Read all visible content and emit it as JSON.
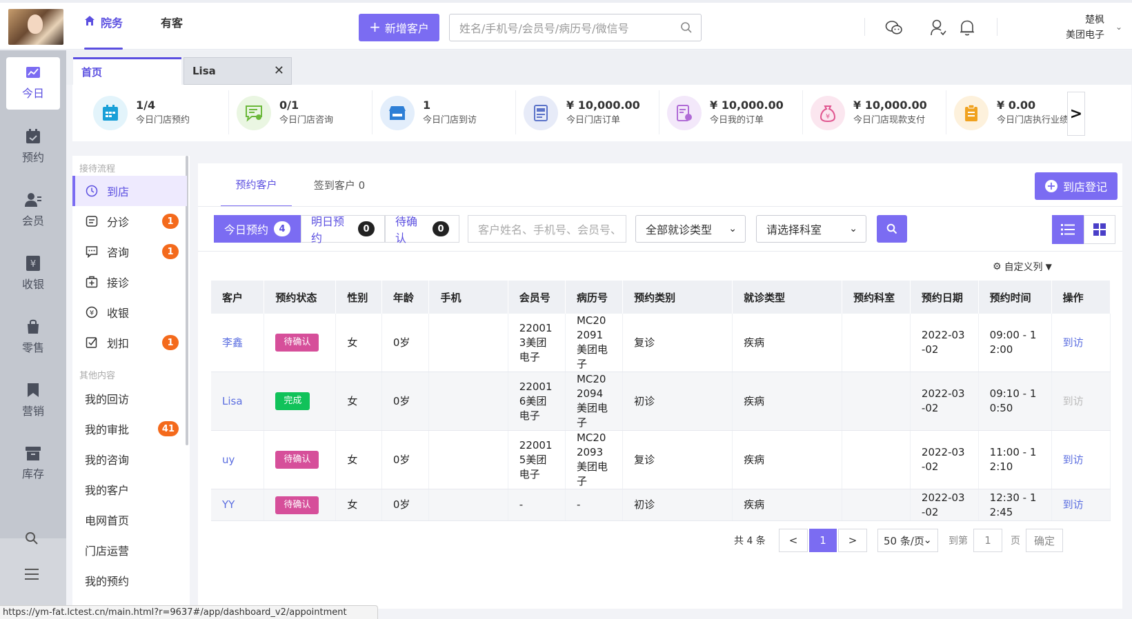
{
  "header": {
    "nav": [
      {
        "label": "院务"
      },
      {
        "label": "有客"
      }
    ],
    "add_customer": "新增客户",
    "search_placeholder": "姓名/手机号/会员号/病历号/微信号",
    "user_name": "楚枫",
    "company": "美团电子"
  },
  "sidebar": {
    "items": [
      {
        "label": "今日",
        "icon": "chart-icon"
      },
      {
        "label": "预约",
        "icon": "calendar-icon"
      },
      {
        "label": "会员",
        "icon": "member-icon"
      },
      {
        "label": "收银",
        "icon": "yen-icon"
      },
      {
        "label": "零售",
        "icon": "bag-icon"
      },
      {
        "label": "营销",
        "icon": "bookmark-icon"
      },
      {
        "label": "库存",
        "icon": "box-icon"
      }
    ]
  },
  "tabs": [
    {
      "label": "首页"
    },
    {
      "label": "Lisa"
    }
  ],
  "stats": [
    {
      "value": "1/4",
      "label": "今日门店预约",
      "color": "#1aa0d8",
      "bg": "#e3f4fb"
    },
    {
      "value": "0/1",
      "label": "今日门店咨询",
      "color": "#6bb83a",
      "bg": "#eaf6e2"
    },
    {
      "value": "1",
      "label": "今日门店到访",
      "color": "#2e7fd6",
      "bg": "#e3eefb"
    },
    {
      "value": "¥ 10,000.00",
      "label": "今日门店订单",
      "color": "#5b73c9",
      "bg": "#e7ebf8"
    },
    {
      "value": "¥ 10,000.00",
      "label": "今日我的订单",
      "color": "#b06bd6",
      "bg": "#f3e8fa"
    },
    {
      "value": "¥ 10,000.00",
      "label": "今日门店现款支付",
      "color": "#e0558f",
      "bg": "#fbe6ef"
    },
    {
      "value": "¥ 0.00",
      "label": "今日门店执行业绩",
      "color": "#f0a21f",
      "bg": "#fdf1dc"
    }
  ],
  "flow_menu": {
    "section1": "接待流程",
    "items1": [
      {
        "label": "到店",
        "badge": ""
      },
      {
        "label": "分诊",
        "badge": "1"
      },
      {
        "label": "咨询",
        "badge": "1"
      },
      {
        "label": "接诊",
        "badge": ""
      },
      {
        "label": "收银",
        "badge": ""
      },
      {
        "label": "划扣",
        "badge": "1"
      }
    ],
    "section2": "其他内容",
    "items2": [
      {
        "label": "我的回访",
        "badge": ""
      },
      {
        "label": "我的审批",
        "badge": "41"
      },
      {
        "label": "我的咨询",
        "badge": ""
      },
      {
        "label": "我的客户",
        "badge": ""
      },
      {
        "label": "电网首页",
        "badge": ""
      },
      {
        "label": "门店运营",
        "badge": ""
      },
      {
        "label": "我的预约",
        "badge": ""
      }
    ]
  },
  "main": {
    "tabs": [
      {
        "label": "预约客户"
      },
      {
        "label": "签到客户 0"
      }
    ],
    "checkin_button": "到店登记",
    "segments": [
      {
        "label": "今日预约",
        "count": "4"
      },
      {
        "label": "明日预约",
        "count": "0"
      },
      {
        "label": "待确认",
        "count": "0"
      }
    ],
    "filter_placeholder": "客户姓名、手机号、会员号、",
    "visit_type_select": "全部就诊类型",
    "dept_select": "请选择科室",
    "custom_columns": "自定义列"
  },
  "table": {
    "columns": [
      "客户",
      "预约状态",
      "性别",
      "年龄",
      "手机",
      "会员号",
      "病历号",
      "预约类别",
      "就诊类型",
      "预约科室",
      "预约日期",
      "预约时间",
      "操作"
    ],
    "rows": [
      {
        "name": "李鑫",
        "status": "待确认",
        "gender": "女",
        "age": "0岁",
        "phone": "",
        "member": "220013美团电子",
        "record": "MC202091美团电子",
        "category": "复诊",
        "visit": "疾病",
        "dept": "",
        "date": "2022-03-02",
        "time": "09:00 - 12:00",
        "action": "到访"
      },
      {
        "name": "Lisa",
        "status": "完成",
        "gender": "女",
        "age": "0岁",
        "phone": "",
        "member": "220016美团电子",
        "record": "MC202094美团电子",
        "category": "初诊",
        "visit": "疾病",
        "dept": "",
        "date": "2022-03-02",
        "time": "09:10 - 10:50",
        "action": "到访"
      },
      {
        "name": "uy",
        "status": "待确认",
        "gender": "女",
        "age": "0岁",
        "phone": "",
        "member": "220015美团电子",
        "record": "MC202093美团电子",
        "category": "复诊",
        "visit": "疾病",
        "dept": "",
        "date": "2022-03-02",
        "time": "11:00 - 12:10",
        "action": "到访"
      },
      {
        "name": "YY",
        "status": "待确认",
        "gender": "女",
        "age": "0岁",
        "phone": "",
        "member": "-",
        "record": "-",
        "category": "初诊",
        "visit": "疾病",
        "dept": "",
        "date": "2022-03-02",
        "time": "12:30 - 12:45",
        "action": "到访"
      }
    ]
  },
  "pagination": {
    "total": "共 4 条",
    "prev": "<",
    "current": "1",
    "next": ">",
    "page_size": "50 条/页",
    "goto_label": "到第",
    "goto_value": "1",
    "page_unit": "页",
    "confirm": "确定"
  },
  "status_url": "https://ym-fat.lctest.cn/main.html?r=9637#/app/dashboard_v2/appointment"
}
